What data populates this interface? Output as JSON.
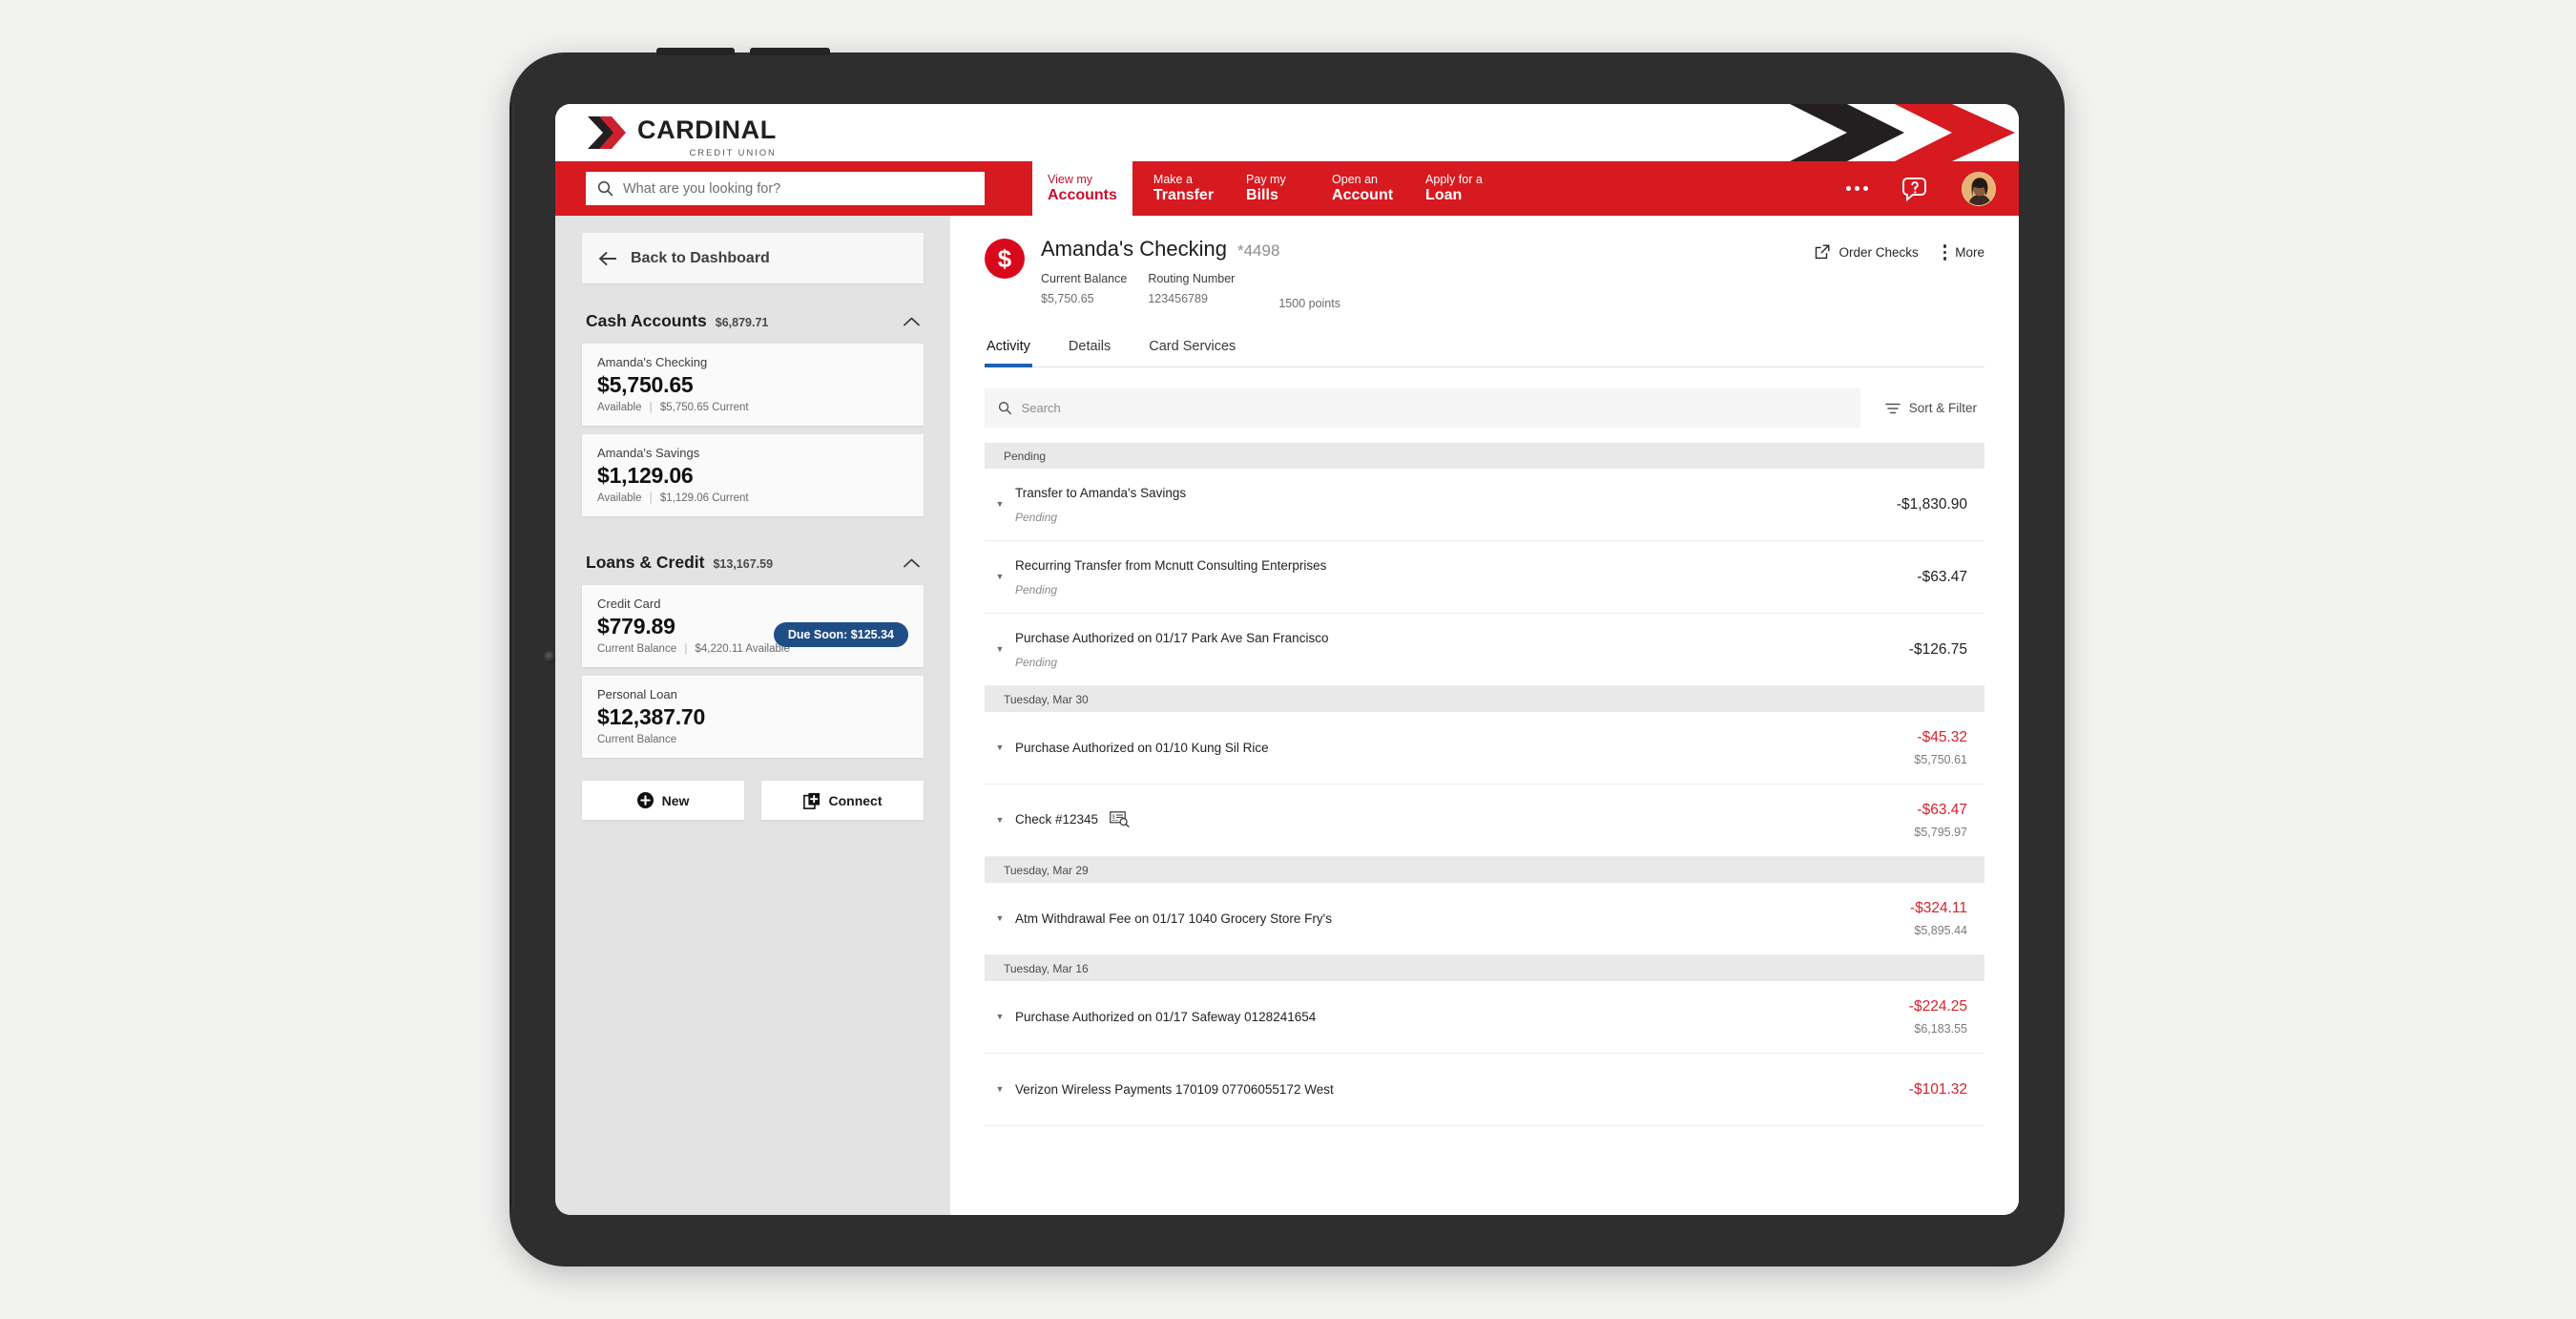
{
  "brand": {
    "name": "CARDINAL",
    "tagline": "CREDIT UNION"
  },
  "colors": {
    "brand_red": "#d71920",
    "logo_dark": "#231f20",
    "accent_blue": "#1d62b5",
    "badge_blue": "#1f4e87",
    "negative_red": "#d8222c"
  },
  "search": {
    "placeholder": "What are you looking for?",
    "value": ""
  },
  "nav": {
    "active": {
      "line1": "View my",
      "line2": "Accounts"
    },
    "items": [
      {
        "line1": "Make a",
        "line2": "Transfer"
      },
      {
        "line1": "Pay my",
        "line2": "Bills"
      },
      {
        "line1": "Open an",
        "line2": "Account"
      },
      {
        "line1": "Apply for a",
        "line2": "Loan"
      }
    ],
    "more_icon": "ellipsis-icon",
    "help_icon": "help-chat-icon",
    "avatar_icon": "user-avatar"
  },
  "sidebar": {
    "back_label": "Back to Dashboard",
    "sections": [
      {
        "title": "Cash Accounts",
        "total": "$6,879.71",
        "accounts": [
          {
            "name": "Amanda's Checking",
            "balance": "$5,750.65",
            "meta_left": "Available",
            "meta_right": "$5,750.65 Current",
            "badge": null
          },
          {
            "name": "Amanda's Savings",
            "balance": "$1,129.06",
            "meta_left": "Available",
            "meta_right": "$1,129.06 Current",
            "badge": null
          }
        ]
      },
      {
        "title": "Loans & Credit",
        "total": "$13,167.59",
        "accounts": [
          {
            "name": "Credit Card",
            "balance": "$779.89",
            "meta_left": "Current Balance",
            "meta_right": "$4,220.11 Available",
            "badge": "Due Soon: $125.34"
          },
          {
            "name": "Personal Loan",
            "balance": "$12,387.70",
            "meta_left": "Current Balance",
            "meta_right": "",
            "badge": null
          }
        ]
      }
    ],
    "actions": [
      {
        "label": "New",
        "icon": "plus-circle-icon"
      },
      {
        "label": "Connect",
        "icon": "connect-plus-icon"
      }
    ]
  },
  "account": {
    "icon": "dollar-sign-icon",
    "title": "Amanda's Checking",
    "mask": "*4498",
    "fields": [
      {
        "key": "Current Balance",
        "value": "$5,750.65"
      },
      {
        "key": "Routing Number",
        "value": "123456789"
      }
    ],
    "points": "1500 points",
    "actions": [
      {
        "label": "Order Checks",
        "icon": "external-link-icon"
      },
      {
        "label": "More",
        "icon": "kebab-icon"
      }
    ]
  },
  "tabs": [
    {
      "label": "Activity",
      "active": true
    },
    {
      "label": "Details",
      "active": false
    },
    {
      "label": "Card Services",
      "active": false
    }
  ],
  "activity": {
    "search_placeholder": "Search",
    "search_value": "",
    "sort_filter_label": "Sort & Filter",
    "groups": [
      {
        "label": "Pending",
        "rows": [
          {
            "description": "Transfer to Amanda's Savings",
            "status": "Pending",
            "amount": "-$1,830.90",
            "balance": "",
            "negative": false,
            "check_icon": false
          },
          {
            "description": "Recurring Transfer from Mcnutt Consulting Enterprises",
            "status": "Pending",
            "amount": "-$63.47",
            "balance": "",
            "negative": false,
            "check_icon": false
          },
          {
            "description": "Purchase Authorized on 01/17 Park Ave San Francisco",
            "status": "Pending",
            "amount": "-$126.75",
            "balance": "",
            "negative": false,
            "check_icon": false
          }
        ]
      },
      {
        "label": "Tuesday, Mar 30",
        "rows": [
          {
            "description": "Purchase Authorized on 01/10 Kung Sil Rice",
            "status": "",
            "amount": "-$45.32",
            "balance": "$5,750.61",
            "negative": true,
            "check_icon": false
          },
          {
            "description": "Check #12345",
            "status": "",
            "amount": "-$63.47",
            "balance": "$5,795.97",
            "negative": true,
            "check_icon": true
          }
        ]
      },
      {
        "label": "Tuesday, Mar 29",
        "rows": [
          {
            "description": "Atm Withdrawal Fee on 01/17 1040 Grocery Store Fry's",
            "status": "",
            "amount": "-$324.11",
            "balance": "$5,895.44",
            "negative": true,
            "check_icon": false
          }
        ]
      },
      {
        "label": "Tuesday, Mar 16",
        "rows": [
          {
            "description": "Purchase Authorized on 01/17 Safeway 0128241654",
            "status": "",
            "amount": "-$224.25",
            "balance": "$6,183.55",
            "negative": true,
            "check_icon": false
          },
          {
            "description": "Verizon Wireless Payments 170109 07706055172 West",
            "status": "",
            "amount": "-$101.32",
            "balance": "",
            "negative": true,
            "check_icon": false
          }
        ]
      }
    ]
  }
}
